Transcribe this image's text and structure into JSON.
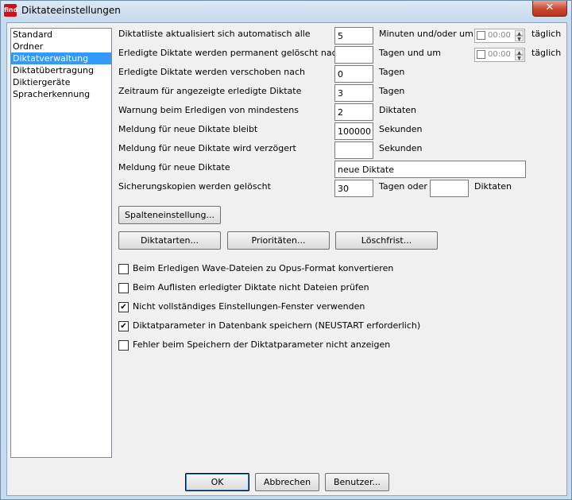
{
  "window": {
    "title": "Diktateeinstellungen",
    "app_icon_text": "find",
    "close_glyph": "✕"
  },
  "nav": {
    "items": [
      "Standard",
      "Ordner",
      "Diktatverwaltung",
      "Diktatübertragung",
      "Diktiergeräte",
      "Spracherkennung"
    ],
    "selected": "Diktatverwaltung"
  },
  "settings": {
    "refresh": {
      "label": "Diktatliste aktualisiert sich automatisch alle",
      "value": "5",
      "unit": "Minuten und/oder um",
      "time": "00:00",
      "suffix": "täglich"
    },
    "delete": {
      "label": "Erledigte Diktate werden permanent gelöscht nach",
      "value": "",
      "unit": "Tagen und um",
      "time": "00:00",
      "suffix": "täglich"
    },
    "move": {
      "label": "Erledigte Diktate werden verschoben nach",
      "value": "0",
      "unit": "Tagen"
    },
    "period": {
      "label": "Zeitraum für angezeigte erledigte Diktate",
      "value": "3",
      "unit": "Tagen"
    },
    "warning": {
      "label": "Warnung beim Erledigen von mindestens",
      "value": "2",
      "unit": "Diktaten"
    },
    "notify_stay": {
      "label": "Meldung für neue Diktate bleibt",
      "value": "100000",
      "unit": "Sekunden"
    },
    "notify_delay": {
      "label": "Meldung für neue Diktate wird verzögert",
      "value": "",
      "unit": "Sekunden"
    },
    "notify_text": {
      "label": "Meldung für neue Diktate",
      "value": "neue Diktate"
    },
    "backup": {
      "label": "Sicherungskopien werden gelöscht",
      "value": "30",
      "unit": "Tagen oder",
      "value2": "",
      "unit2": "Diktaten"
    }
  },
  "buttons": {
    "columns": "Spalteneinstellung...",
    "types": "Diktatarten...",
    "priorities": "Prioritäten...",
    "delete_deadline": "Löschfrist...",
    "ok": "OK",
    "cancel": "Abbrechen",
    "user": "Benutzer..."
  },
  "checkboxes": [
    {
      "label": "Beim Erledigen Wave-Dateien zu Opus-Format konvertieren",
      "checked": false
    },
    {
      "label": "Beim Auflisten erledigter Diktate nicht Dateien prüfen",
      "checked": false
    },
    {
      "label": "Nicht vollständiges Einstellungen-Fenster verwenden",
      "checked": true
    },
    {
      "label": "Diktatparameter in Datenbank speichern (NEUSTART erforderlich)",
      "checked": true
    },
    {
      "label": "Fehler beim Speichern der Diktatparameter nicht anzeigen",
      "checked": false
    }
  ],
  "check_glyph": "✔"
}
